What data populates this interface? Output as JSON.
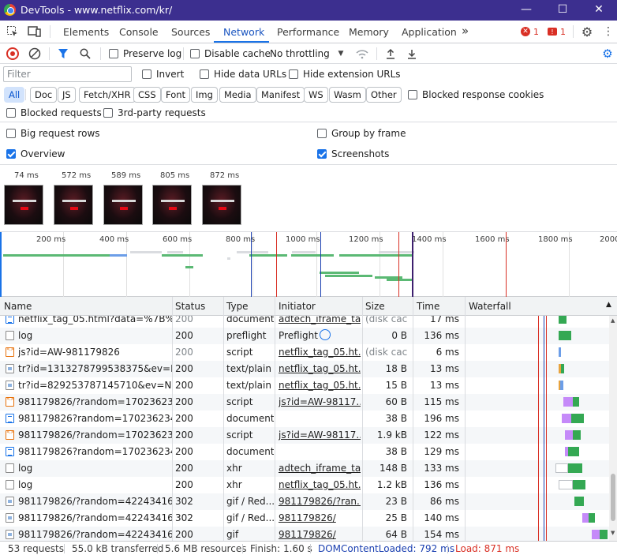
{
  "window": {
    "title": "DevTools - www.netflix.com/kr/",
    "min": "—",
    "max": "☐",
    "close": "✕"
  },
  "tabs": [
    {
      "label": "Elements"
    },
    {
      "label": "Console"
    },
    {
      "label": "Sources"
    },
    {
      "label": "Network",
      "active": true
    },
    {
      "label": "Performance"
    },
    {
      "label": "Memory"
    },
    {
      "label": "Application"
    }
  ],
  "tabbar": {
    "more": "»",
    "errors": "1",
    "issues": "1"
  },
  "toolbar": {
    "preserve_log": "Preserve log",
    "disable_cache": "Disable cache",
    "throttling": "No throttling"
  },
  "filter": {
    "placeholder": "Filter",
    "invert": "Invert",
    "hide_data_urls": "Hide data URLs",
    "hide_extension_urls": "Hide extension URLs",
    "types": [
      "All",
      "Doc",
      "JS",
      "Fetch/XHR",
      "CSS",
      "Font",
      "Img",
      "Media",
      "Manifest",
      "WS",
      "Wasm",
      "Other"
    ],
    "blocked_response_cookies": "Blocked response cookies",
    "blocked_requests": "Blocked requests",
    "third_party": "3rd-party requests"
  },
  "settings": {
    "big_request_rows": "Big request rows",
    "group_by_frame": "Group by frame",
    "overview": "Overview",
    "screenshots": "Screenshots"
  },
  "screenshots": [
    "74 ms",
    "572 ms",
    "589 ms",
    "805 ms",
    "872 ms"
  ],
  "overview_ticks": [
    "200 ms",
    "400 ms",
    "600 ms",
    "800 ms",
    "1000 ms",
    "1200 ms",
    "1400 ms",
    "1600 ms",
    "1800 ms",
    "2000"
  ],
  "columns": {
    "name": "Name",
    "status": "Status",
    "type": "Type",
    "initiator": "Initiator",
    "size": "Size",
    "time": "Time",
    "waterfall": "Waterfall"
  },
  "rows": [
    {
      "name": "netflix_tag_05.html?data=%7B%2...",
      "status": "200",
      "type": "document",
      "initiator": "adtech_iframe_ta...",
      "size": "(disk cac...",
      "time": "17 ms",
      "icon": "doc"
    },
    {
      "name": "log",
      "status": "200",
      "type": "preflight",
      "initiator": "Preflight",
      "size": "0 B",
      "time": "136 ms",
      "icon": "plain"
    },
    {
      "name": "js?id=AW-981179826",
      "status": "200",
      "type": "script",
      "initiator": "netflix_tag_05.ht...",
      "size": "(disk cac...",
      "time": "6 ms",
      "icon": "script"
    },
    {
      "name": "tr?id=1313278799538375&ev=Pu...",
      "status": "200",
      "type": "text/plain",
      "initiator": "netflix_tag_05.ht...",
      "size": "18 B",
      "time": "13 ms",
      "icon": "img"
    },
    {
      "name": "tr?id=829253787145710&ev=NM...",
      "status": "200",
      "type": "text/plain",
      "initiator": "netflix_tag_05.ht...",
      "size": "15 B",
      "time": "13 ms",
      "icon": "img"
    },
    {
      "name": "981179826/?random=170236234...",
      "status": "200",
      "type": "script",
      "initiator": "js?id=AW-98117...",
      "size": "60 B",
      "time": "115 ms",
      "icon": "script"
    },
    {
      "name": "981179826?random=1702362342...",
      "status": "200",
      "type": "document",
      "initiator": "",
      "size": "38 B",
      "time": "196 ms",
      "icon": "doc"
    },
    {
      "name": "981179826/?random=170236234...",
      "status": "200",
      "type": "script",
      "initiator": "js?id=AW-98117...",
      "size": "1.9 kB",
      "time": "122 ms",
      "icon": "script"
    },
    {
      "name": "981179826?random=1702362343...",
      "status": "200",
      "type": "document",
      "initiator": "",
      "size": "38 B",
      "time": "129 ms",
      "icon": "doc"
    },
    {
      "name": "log",
      "status": "200",
      "type": "xhr",
      "initiator": "adtech_iframe_ta...",
      "size": "148 B",
      "time": "133 ms",
      "icon": "plain"
    },
    {
      "name": "log",
      "status": "200",
      "type": "xhr",
      "initiator": "netflix_tag_05.ht...",
      "size": "1.2 kB",
      "time": "136 ms",
      "icon": "plain"
    },
    {
      "name": "981179826/?random=422434165...",
      "status": "302",
      "type": "gif / Red...",
      "initiator": "981179826/?ran...",
      "size": "23 B",
      "time": "86 ms",
      "icon": "img"
    },
    {
      "name": "981179826/?random=422434165...",
      "status": "302",
      "type": "gif / Red...",
      "initiator": "981179826/",
      "size": "25 B",
      "time": "140 ms",
      "icon": "img"
    },
    {
      "name": "981179826/?random=422434165...",
      "status": "200",
      "type": "gif",
      "initiator": "981179826/",
      "size": "64 B",
      "time": "154 ms",
      "icon": "img"
    }
  ],
  "status": {
    "requests": "53 requests",
    "transferred": "55.0 kB transferred",
    "resources": "5.6 MB resources",
    "finish": "Finish: 1.60 s",
    "dom_content_loaded": "DOMContentLoaded: 792 ms",
    "load": "Load: 871 ms"
  },
  "colors": {
    "titlebar": "#3c2f8f",
    "accent": "#1a73e8",
    "dcl": "#1a3fb0",
    "load": "#d93025",
    "green": "#34a853"
  }
}
